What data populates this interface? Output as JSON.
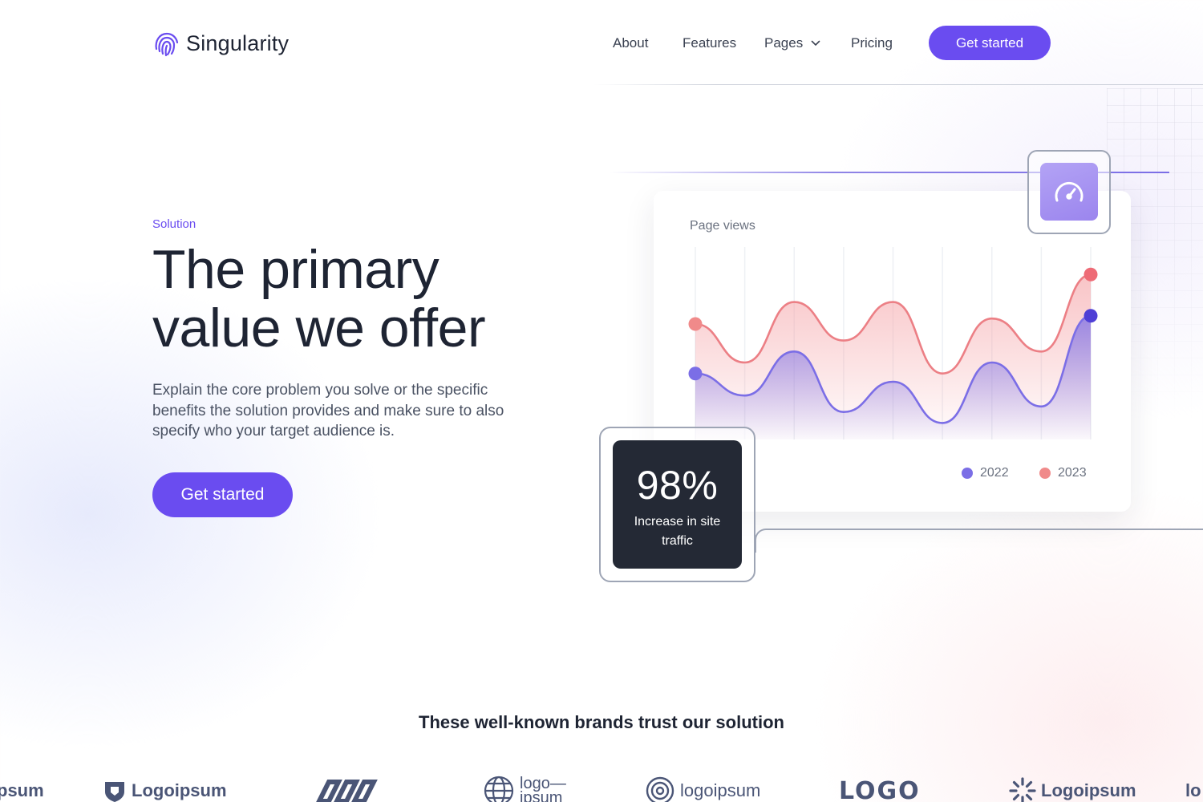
{
  "nav": {
    "brand": "Singularity",
    "links": [
      "About",
      "Features",
      "Pages",
      "Pricing"
    ],
    "cta": "Get started"
  },
  "hero": {
    "eyebrow": "Solution",
    "headline": [
      "The primary",
      "value we offer"
    ],
    "subtext": "Explain the core problem you solve or the specific benefits the solution provides and make sure to also specify who your target audience is.",
    "cta": "Get started"
  },
  "stat": {
    "value": "98%",
    "label": "Increase in site traffic"
  },
  "chart_data": {
    "type": "area",
    "title": "Page views",
    "x": [
      0,
      1,
      2,
      3,
      4,
      5,
      6,
      7,
      8
    ],
    "series": [
      {
        "name": "2022",
        "color": "#7b6ee6",
        "values": [
          2.4,
          1.6,
          3.2,
          1.0,
          2.1,
          0.6,
          2.8,
          1.2,
          4.5
        ]
      },
      {
        "name": "2023",
        "color": "#f08a8a",
        "values": [
          4.2,
          2.8,
          5.0,
          3.6,
          5.0,
          2.4,
          4.4,
          3.2,
          6.0
        ]
      }
    ],
    "ylim": [
      0,
      7
    ],
    "grid": true,
    "legend": "bottom-right"
  },
  "colors": {
    "accent": "#6a4cf0",
    "dark": "#242935"
  },
  "icons": {
    "logo": "fingerprint-icon",
    "chevron": "chevron-down-icon",
    "gauge": "speedometer-icon"
  },
  "brands": {
    "title": "These well-known brands trust our solution",
    "items": [
      "psum",
      "Logoipsum",
      "logo— ipsum",
      "logoipsum",
      "LOGO",
      "Logoipsum",
      "lo"
    ]
  }
}
